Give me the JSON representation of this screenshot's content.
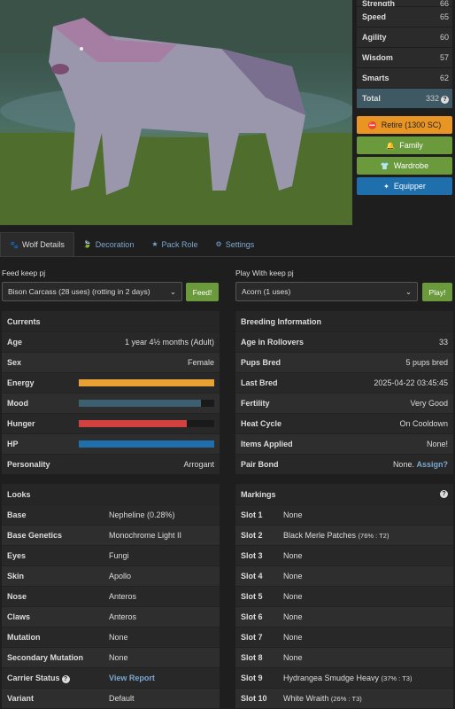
{
  "stats": [
    {
      "label": "Strength",
      "value": "66"
    },
    {
      "label": "Speed",
      "value": "65"
    },
    {
      "label": "Agility",
      "value": "60"
    },
    {
      "label": "Wisdom",
      "value": "57"
    },
    {
      "label": "Smarts",
      "value": "62"
    },
    {
      "label": "Total",
      "value": "332"
    }
  ],
  "actions": {
    "retire": "Retire (1300 SC)",
    "family": "Family",
    "wardrobe": "Wardrobe",
    "equipper": "Equipper"
  },
  "tabs": [
    "Wolf Details",
    "Decoration",
    "Pack Role",
    "Settings"
  ],
  "feed": {
    "label": "Feed keep pj",
    "value": "Bison Carcass (28 uses) (rotting in 2 days)",
    "button": "Feed!"
  },
  "play": {
    "label": "Play With keep pj",
    "value": "Acorn (1 uses)",
    "button": "Play!"
  },
  "currents": {
    "title": "Currents",
    "age": {
      "label": "Age",
      "value": "1 year 4½ months (Adult)"
    },
    "sex": {
      "label": "Sex",
      "value": "Female"
    },
    "energy": {
      "label": "Energy",
      "fraction": 1.0,
      "color": "#e8a133"
    },
    "mood": {
      "label": "Mood",
      "fraction": 0.9,
      "color": "#3d5f72"
    },
    "hunger": {
      "label": "Hunger",
      "fraction": 0.8,
      "color": "#d24040"
    },
    "hp": {
      "label": "HP",
      "fraction": 1.0,
      "color": "#1f6fad"
    },
    "personality": {
      "label": "Personality",
      "value": "Arrogant"
    }
  },
  "breeding": {
    "title": "Breeding Information",
    "rows": [
      {
        "label": "Age in Rollovers",
        "value": "33"
      },
      {
        "label": "Pups Bred",
        "value": "5 pups bred"
      },
      {
        "label": "Last Bred",
        "value": "2025-04-22 03:45:45"
      },
      {
        "label": "Fertility",
        "value": "Very Good"
      },
      {
        "label": "Heat Cycle",
        "value": "On Cooldown"
      },
      {
        "label": "Items Applied",
        "value": "None!"
      }
    ],
    "pair_bond": {
      "label": "Pair Bond",
      "value": "None.",
      "link": "Assign?"
    }
  },
  "looks": {
    "title": "Looks",
    "rows": [
      {
        "label": "Base",
        "value": "Nepheline (0.28%)"
      },
      {
        "label": "Base Genetics",
        "value": "Monochrome Light II"
      },
      {
        "label": "Eyes",
        "value": "Fungi"
      },
      {
        "label": "Skin",
        "value": "Apollo"
      },
      {
        "label": "Nose",
        "value": "Anteros"
      },
      {
        "label": "Claws",
        "value": "Anteros"
      },
      {
        "label": "Mutation",
        "value": "None"
      },
      {
        "label": "Secondary Mutation",
        "value": "None"
      }
    ],
    "carrier": {
      "label": "Carrier Status",
      "link": "View Report"
    },
    "variant": {
      "label": "Variant",
      "value": "Default"
    }
  },
  "markings": {
    "title": "Markings",
    "rows": [
      {
        "label": "Slot 1",
        "value": "None",
        "detail": ""
      },
      {
        "label": "Slot 2",
        "value": "Black Merle Patches",
        "detail": "(76% : T2)"
      },
      {
        "label": "Slot 3",
        "value": "None",
        "detail": ""
      },
      {
        "label": "Slot 4",
        "value": "None",
        "detail": ""
      },
      {
        "label": "Slot 5",
        "value": "None",
        "detail": ""
      },
      {
        "label": "Slot 6",
        "value": "None",
        "detail": ""
      },
      {
        "label": "Slot 7",
        "value": "None",
        "detail": ""
      },
      {
        "label": "Slot 8",
        "value": "None",
        "detail": ""
      },
      {
        "label": "Slot 9",
        "value": "Hydrangea Smudge Heavy",
        "detail": "(37% : T3)"
      },
      {
        "label": "Slot 10",
        "value": "White Wraith",
        "detail": "(26% : T3)"
      }
    ]
  }
}
